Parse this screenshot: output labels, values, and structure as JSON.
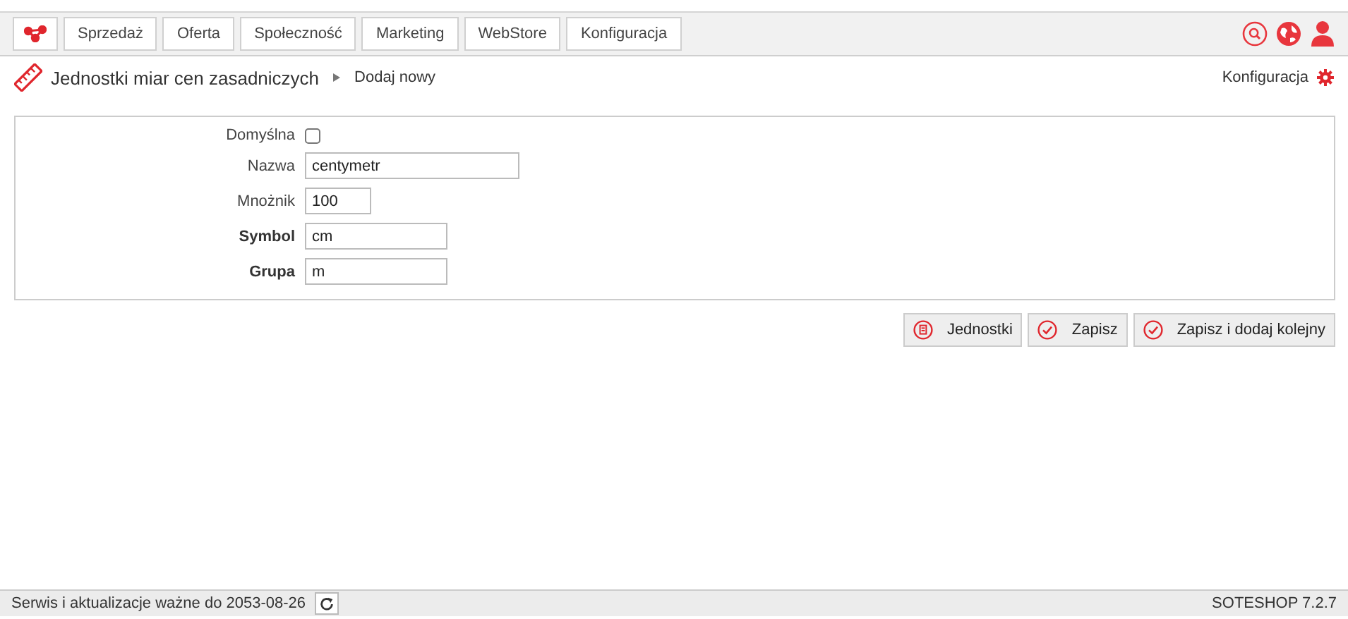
{
  "top_menu": [
    {
      "label": "Sprzedaż"
    },
    {
      "label": "Oferta"
    },
    {
      "label": "Społeczność"
    },
    {
      "label": "Marketing"
    },
    {
      "label": "WebStore"
    },
    {
      "label": "Konfiguracja"
    }
  ],
  "breadcrumb": {
    "title": "Jednostki miar cen zasadniczych",
    "current": "Dodaj nowy",
    "config_link": "Konfiguracja"
  },
  "form": [
    {
      "kind": "checkbox",
      "label": "Domyślna",
      "checked": false,
      "required": false
    },
    {
      "kind": "text",
      "label": "Nazwa",
      "value": "centymetr",
      "required": false
    },
    {
      "kind": "text",
      "label": "Mnożnik",
      "value": "100",
      "required": false
    },
    {
      "kind": "text",
      "label": "Symbol",
      "value": "cm",
      "required": true
    },
    {
      "kind": "text",
      "label": "Grupa",
      "value": "m",
      "required": true
    }
  ],
  "buttons": [
    {
      "kind": "list",
      "label": "Jednostki"
    },
    {
      "kind": "save",
      "label": "Zapisz"
    },
    {
      "kind": "save",
      "label": "Zapisz i dodaj kolejny"
    }
  ],
  "status_bar": {
    "service": "Serwis i aktualizacje ważne do 2053-08-26",
    "version": "SOTESHOP 7.2.7"
  }
}
